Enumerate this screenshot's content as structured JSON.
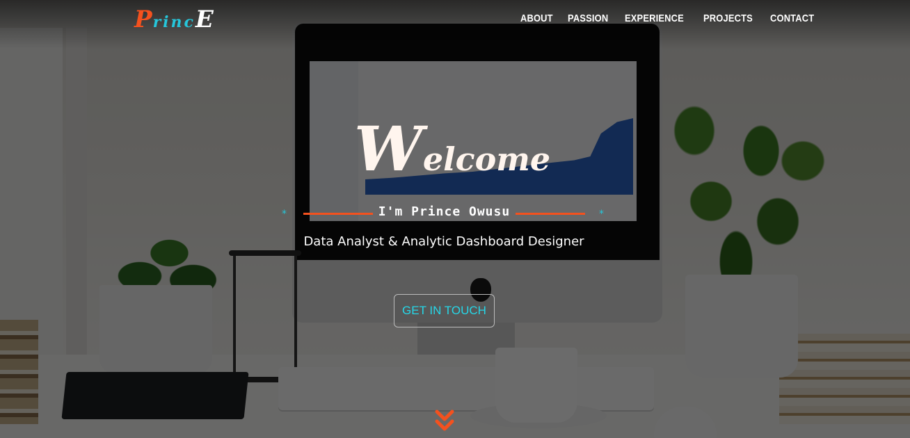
{
  "header": {
    "logo": {
      "first": "P",
      "middle": "rinc",
      "last": "E"
    },
    "nav": [
      {
        "label": "ABOUT"
      },
      {
        "label": "PASSION"
      },
      {
        "label": "EXPERIENCE"
      },
      {
        "label": "PROJECTS"
      },
      {
        "label": "CONTACT"
      }
    ]
  },
  "hero": {
    "welcome_first": "W",
    "welcome_rest": "elcome",
    "greeting": "I'm Prince Owusu",
    "star_left": "*",
    "star_right": "*",
    "role": "Data Analyst & Analytic Dashboard Designer",
    "cta_label": "GET IN TOUCH"
  },
  "icons": {
    "scroll": "chevron-double-down-icon"
  },
  "colors": {
    "accent_orange": "#f4511e",
    "accent_cyan": "#26c6da",
    "text_light": "#ffffff"
  }
}
